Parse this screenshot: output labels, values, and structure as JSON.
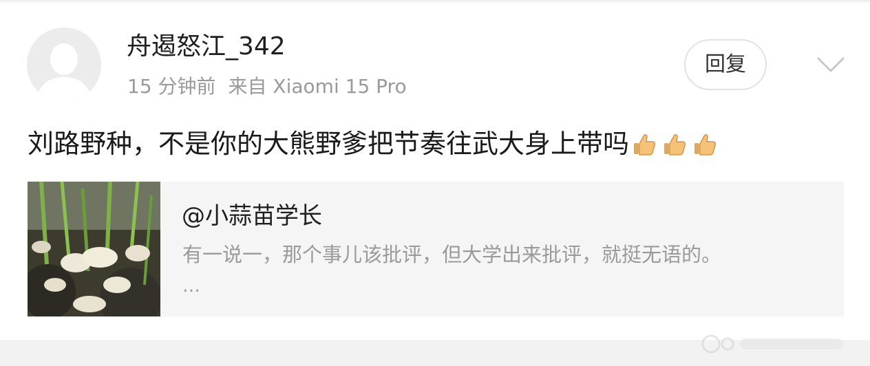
{
  "post": {
    "author": "舟遏怒江_342",
    "time": "15 分钟前",
    "source": "来自 Xiaomi 15 Pro",
    "reply_label": "回复",
    "content": "刘路野种，不是你的大熊野爹把节奏往武大身上带吗",
    "emoji": [
      "thumbs-up-icon",
      "thumbs-up-icon",
      "thumbs-up-icon"
    ]
  },
  "quote": {
    "author": "@小蒜苗学长",
    "text": "有一说一，那个事儿该批评，但大学出来批评，就挺无语的。",
    "ellipsis": "…"
  },
  "colors": {
    "meta_gray": "#9a9a9a",
    "quote_bg": "#f5f5f5",
    "avatar_bg": "#ececec"
  }
}
